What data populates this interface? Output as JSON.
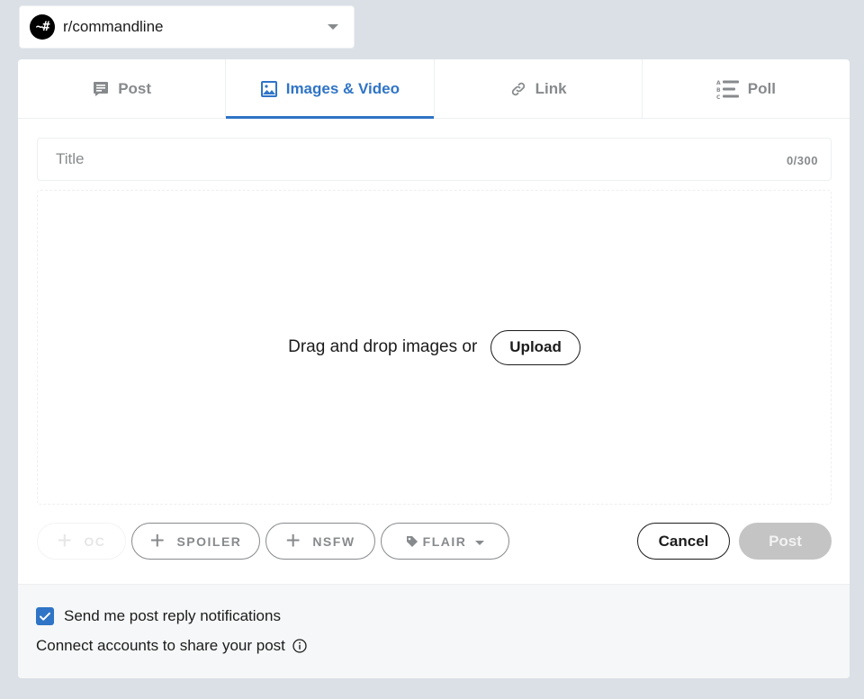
{
  "community": {
    "avatar_text": "~#",
    "name": "r/commandline"
  },
  "tabs": [
    {
      "label": "Post",
      "icon": "post-icon",
      "active": false
    },
    {
      "label": "Images & Video",
      "icon": "image-icon",
      "active": true
    },
    {
      "label": "Link",
      "icon": "link-icon",
      "active": false
    },
    {
      "label": "Poll",
      "icon": "poll-icon",
      "active": false
    }
  ],
  "title_field": {
    "placeholder": "Title",
    "value": "",
    "char_count": "0/300"
  },
  "dropzone": {
    "text": "Drag and drop images or",
    "upload_label": "Upload"
  },
  "tags": {
    "oc": "OC",
    "spoiler": "SPOILER",
    "nsfw": "NSFW",
    "flair": "FLAIR"
  },
  "actions": {
    "cancel_label": "Cancel",
    "post_label": "Post"
  },
  "footer": {
    "notify_label": "Send me post reply notifications",
    "notify_checked": true,
    "connect_label": "Connect accounts to share your post"
  },
  "colors": {
    "accent": "#2f74c6",
    "background": "#dae0e6",
    "muted": "#878a8c",
    "disabled_button": "#c4c4c4"
  }
}
